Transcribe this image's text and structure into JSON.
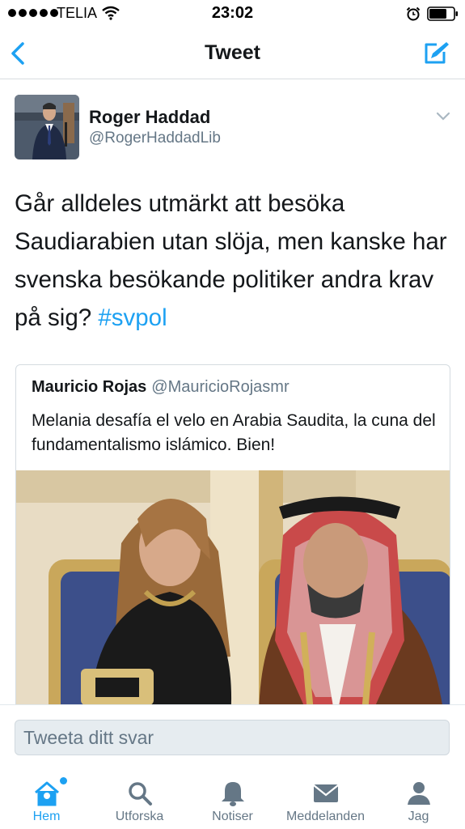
{
  "status_bar": {
    "carrier": "TELIA",
    "time": "23:02"
  },
  "nav": {
    "title": "Tweet"
  },
  "tweet": {
    "author_name": "Roger Haddad",
    "author_handle": "@RogerHaddadLib",
    "text": "Går alldeles utmärkt att besöka Saudiarabien utan slöja, men kanske har svenska besökande politiker andra krav på sig?",
    "hashtag": "#svpol"
  },
  "quoted_tweet": {
    "author_name": "Mauricio Rojas",
    "author_handle": "@MauricioRojasmr",
    "text": "Melania desafía el velo en Arabia Saudita, la cuna del fundamentalismo islámico. Bien!"
  },
  "reply": {
    "placeholder": "Tweeta ditt svar"
  },
  "tabs": [
    {
      "label": "Hem",
      "icon": "home-icon"
    },
    {
      "label": "Utforska",
      "icon": "search-icon"
    },
    {
      "label": "Notiser",
      "icon": "bell-icon"
    },
    {
      "label": "Meddelanden",
      "icon": "envelope-icon"
    },
    {
      "label": "Jag",
      "icon": "profile-icon"
    }
  ],
  "colors": {
    "accent": "#1da1f2",
    "secondary_text": "#657786"
  }
}
